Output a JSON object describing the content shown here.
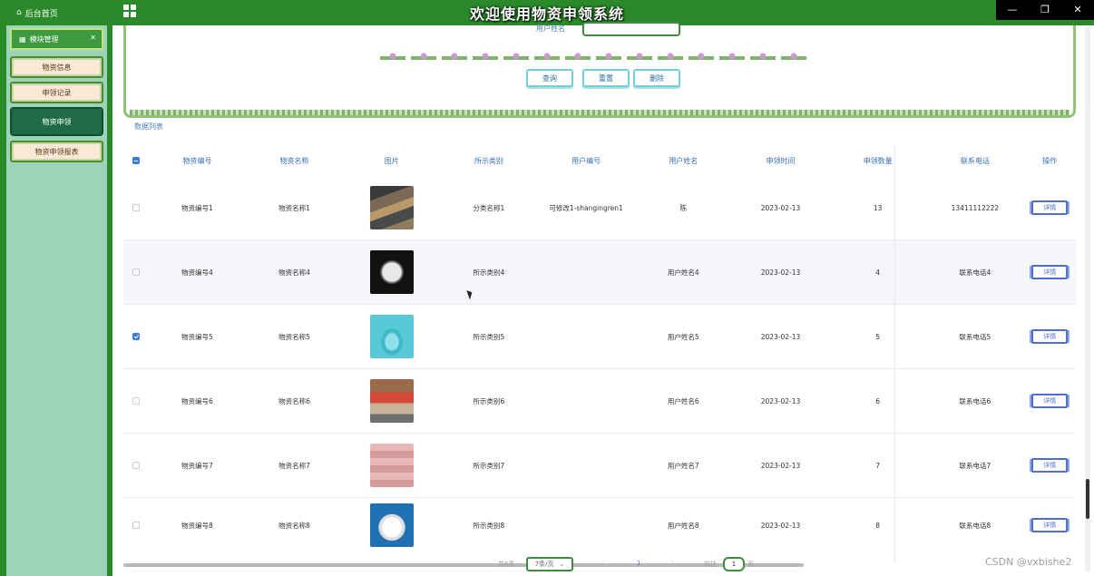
{
  "header": {
    "home_label": "后台首页",
    "title": "欢迎使用物资申领系统",
    "window_controls": [
      "—",
      "❐",
      "✕"
    ]
  },
  "sidebar": {
    "section_label": "模块管理",
    "items": [
      "物资信息",
      "申领记录",
      "物资申领",
      "物资申领报表"
    ],
    "active_index": 2
  },
  "search": {
    "field_label": "用户姓名",
    "field_value": "",
    "buttons": [
      "查询",
      "重置",
      "删除"
    ]
  },
  "list_title": "数据列表",
  "table": {
    "columns": [
      "物资编号",
      "物资名称",
      "图片",
      "所示类别",
      "用户编号",
      "用户姓名",
      "申领时间",
      "申领数量",
      "联系电话",
      "操作"
    ],
    "rows": [
      {
        "checked": false,
        "code": "物资编号1",
        "name": "物资名称1",
        "image": "warehouse-image",
        "category": "分类名称1",
        "user_code": "可修改1-shangingren1",
        "user_name": "陈",
        "time": "2023-02-13",
        "qty": "13",
        "phone": "13411112222",
        "action": "详情"
      },
      {
        "checked": false,
        "code": "物资编号4",
        "name": "物资名称4",
        "image": "mask-black-image",
        "category": "所示类别4",
        "user_code": "",
        "user_name": "用户姓名4",
        "time": "2023-02-13",
        "qty": "4",
        "phone": "联系电话4",
        "action": "详情"
      },
      {
        "checked": true,
        "code": "物资编号5",
        "name": "物资名称5",
        "image": "mask-blue-image",
        "category": "所示类别5",
        "user_code": "",
        "user_name": "用户姓名5",
        "time": "2023-02-13",
        "qty": "5",
        "phone": "联系电话5",
        "action": "详情"
      },
      {
        "checked": false,
        "code": "物资编号6",
        "name": "物资名称6",
        "image": "supplies-image",
        "category": "所示类别6",
        "user_code": "",
        "user_name": "用户姓名6",
        "time": "2023-02-13",
        "qty": "6",
        "phone": "联系电话6",
        "action": "详情"
      },
      {
        "checked": false,
        "code": "物资编号7",
        "name": "物资名称7",
        "image": "boxes-image",
        "category": "所示类别7",
        "user_code": "",
        "user_name": "用户姓名7",
        "time": "2023-02-13",
        "qty": "7",
        "phone": "联系电话7",
        "action": "详情"
      },
      {
        "checked": false,
        "code": "物资编号8",
        "name": "物资名称8",
        "image": "respirator-image",
        "category": "所示类别8",
        "user_code": "",
        "user_name": "用户姓名8",
        "time": "2023-02-13",
        "qty": "8",
        "phone": "联系电话8",
        "action": "详情"
      }
    ]
  },
  "pagination": {
    "total_label": "共6条",
    "page_size": "7条/页",
    "prev": "‹",
    "current": "1",
    "next": "›",
    "goto_label": "前往",
    "goto_value": "1",
    "page_suffix": "页"
  },
  "watermark": "CSDN @vxbishe2",
  "colors": {
    "brand_green": "#2a8a2a",
    "sidebar_bg": "#9bd4b8",
    "accent_blue": "#3a7bd5"
  }
}
